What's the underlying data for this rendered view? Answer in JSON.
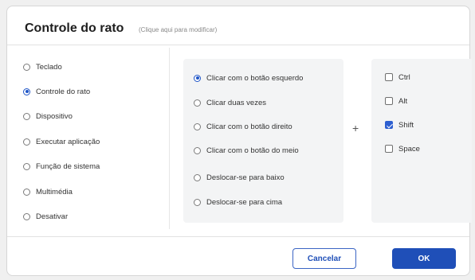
{
  "dialog": {
    "title": "Controle do rato",
    "hint": "(Clique aqui para modificar)"
  },
  "categories": [
    {
      "label": "Teclado",
      "selected": false
    },
    {
      "label": "Controle do rato",
      "selected": true
    },
    {
      "label": "Dispositivo",
      "selected": false
    },
    {
      "label": "Executar aplicação",
      "selected": false
    },
    {
      "label": "Função de sistema",
      "selected": false
    },
    {
      "label": "Multimédia",
      "selected": false
    },
    {
      "label": "Desativar",
      "selected": false
    }
  ],
  "mouse_actions": [
    {
      "label": "Clicar com o botão esquerdo",
      "selected": true
    },
    {
      "label": "Clicar duas vezes",
      "selected": false
    },
    {
      "label": "Clicar com o botão direito",
      "selected": false
    },
    {
      "label": "Clicar com o botão do meio",
      "selected": false
    },
    {
      "label": "Deslocar-se para baixo",
      "selected": false
    },
    {
      "label": "Deslocar-se para cima",
      "selected": false
    }
  ],
  "plus_sign": "+",
  "modifiers": [
    {
      "label": "Ctrl",
      "checked": false
    },
    {
      "label": "Alt",
      "checked": false
    },
    {
      "label": "Shift",
      "checked": true
    },
    {
      "label": "Space",
      "checked": false
    }
  ],
  "buttons": {
    "cancel": "Cancelar",
    "ok": "OK"
  },
  "colors": {
    "accent": "#1f4fb8",
    "panel": "#f3f4f5"
  }
}
